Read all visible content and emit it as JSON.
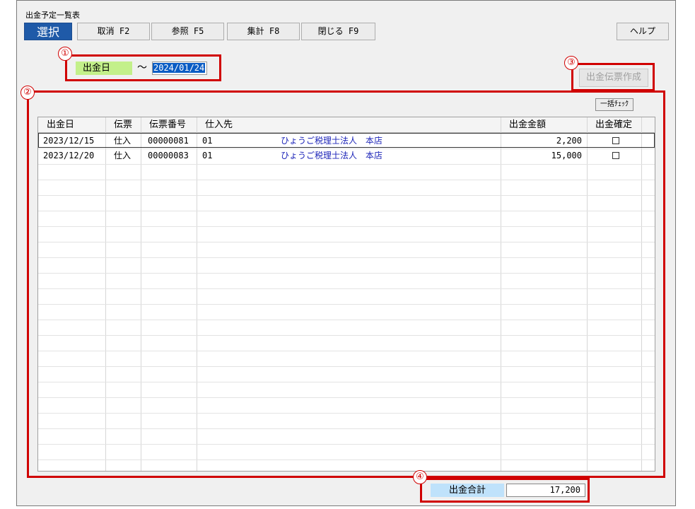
{
  "window": {
    "title": "出金予定一覧表"
  },
  "toolbar": {
    "select_label": "選択",
    "buttons": [
      "取消 F2",
      "参照 F5",
      "集計 F8",
      "閉じる F9"
    ],
    "help_label": "ヘルプ"
  },
  "filter": {
    "date_label": "出金日",
    "tilde": "～",
    "date_value": "2024/01/24"
  },
  "actions": {
    "create_slip_label": "出金伝票作成",
    "bulk_check_label": "一括ﾁｪｯｸ"
  },
  "markers": [
    "①",
    "②",
    "③",
    "④"
  ],
  "table": {
    "headers": [
      "出金日",
      "伝票",
      "伝票番号",
      "仕入先",
      "出金金額",
      "出金確定"
    ],
    "rows": [
      {
        "date": "2023/12/15",
        "slip": "仕入",
        "number": "00000081",
        "code": "01",
        "supplier": "ひょうご税理士法人　本店",
        "amount": "2,200",
        "confirmed": false
      },
      {
        "date": "2023/12/20",
        "slip": "仕入",
        "number": "00000083",
        "code": "01",
        "supplier": "ひょうご税理士法人　本店",
        "amount": "15,000",
        "confirmed": false
      }
    ]
  },
  "summary": {
    "total_label": "出金合計",
    "total_value": "17,200"
  }
}
